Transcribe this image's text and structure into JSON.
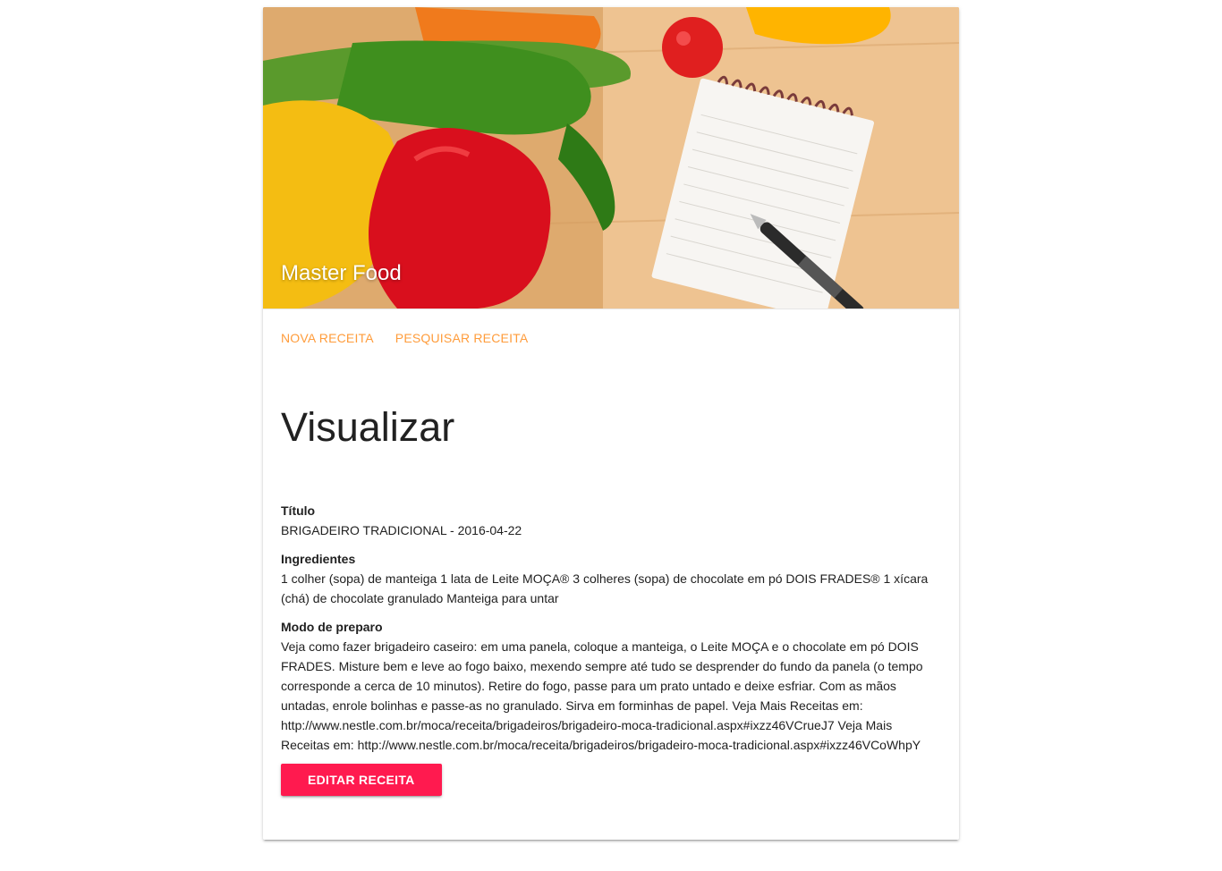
{
  "header": {
    "app_title": "Master Food"
  },
  "nav": {
    "items": [
      {
        "label": "NOVA RECEITA"
      },
      {
        "label": "PESQUISAR RECEITA"
      }
    ]
  },
  "main": {
    "page_title": "Visualizar",
    "fields": [
      {
        "label": "Título",
        "value": "BRIGADEIRO TRADICIONAL - 2016-04-22"
      },
      {
        "label": "Ingredientes",
        "value": "1 colher (sopa) de manteiga 1 lata de Leite MOÇA® 3 colheres (sopa) de chocolate em pó DOIS FRADES® 1 xícara (chá) de chocolate granulado Manteiga para untar"
      },
      {
        "label": "Modo de preparo",
        "value": "Veja como fazer brigadeiro caseiro: em uma panela, coloque a manteiga, o Leite MOÇA e o chocolate em pó DOIS FRADES. Misture bem e leve ao fogo baixo, mexendo sempre até tudo se desprender do fundo da panela (o tempo corresponde a cerca de 10 minutos). Retire do fogo, passe para um prato untado e deixe esfriar. Com as mãos untadas, enrole bolinhas e passe-as no granulado. Sirva em forminhas de papel. Veja Mais Receitas em: http://www.nestle.com.br/moca/receita/brigadeiros/brigadeiro-moca-tradicional.aspx#ixzz46VCrueJ7 Veja Mais Receitas em: http://www.nestle.com.br/moca/receita/brigadeiros/brigadeiro-moca-tradicional.aspx#ixzz46VCoWhpY"
      }
    ],
    "edit_button_label": "EDITAR RECEITA"
  },
  "colors": {
    "accent": "#ff9c3b",
    "button": "#ff1a4f"
  }
}
